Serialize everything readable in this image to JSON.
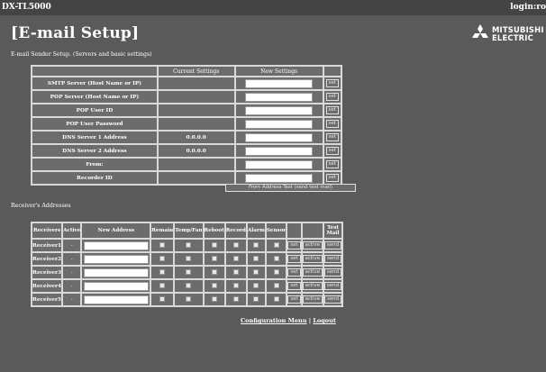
{
  "header": {
    "product": "DX-TL5000",
    "login": "login:ro",
    "title": "[E-mail Setup]",
    "subtitle": "E-mail Sender Setup. (Servers and basic settings)"
  },
  "logo": {
    "line1": "MITSUBISHI",
    "line2": "ELECTRIC"
  },
  "sender": {
    "columns": [
      "",
      "Current Settings",
      "New Settings",
      ""
    ],
    "rows": [
      {
        "label": "SMTP Server (Host Name or IP)",
        "current": "",
        "button": "set"
      },
      {
        "label": "POP Server (Host Name or IP)",
        "current": "",
        "button": "set"
      },
      {
        "label": "POP User ID",
        "current": "",
        "button": "set"
      },
      {
        "label": "POP User Password",
        "current": "",
        "button": "set"
      },
      {
        "label": "DNS Server 1 Address",
        "current": "0.0.0.0",
        "button": "set"
      },
      {
        "label": "DNS Server 2 Address",
        "current": "0.0.0.0",
        "button": "set"
      },
      {
        "label": "From:",
        "current": "",
        "button": "set"
      },
      {
        "label": "Recorder ID",
        "current": "",
        "button": "set"
      }
    ],
    "test_button": "From Address Test (send test mail)"
  },
  "receivers": {
    "title": "Receiver's Addresses",
    "columns": [
      "Receivers",
      "Active",
      "New Address",
      "Remain",
      "Temp/Fan",
      "Reboot",
      "Record",
      "Alarm",
      "Sensor",
      "",
      "",
      "Test Mail"
    ],
    "rows": [
      {
        "name": "Receiver1",
        "active": "-",
        "set": "set",
        "activate": "active",
        "send": "send"
      },
      {
        "name": "Receiver2",
        "active": "-",
        "set": "set",
        "activate": "active",
        "send": "send"
      },
      {
        "name": "Receiver3",
        "active": "-",
        "set": "set",
        "activate": "active",
        "send": "send"
      },
      {
        "name": "Receiver4",
        "active": "-",
        "set": "set",
        "activate": "active",
        "send": "send"
      },
      {
        "name": "Receiver5",
        "active": "-",
        "set": "set",
        "activate": "active",
        "send": "send"
      }
    ]
  },
  "footer": {
    "config_link": "Configuration Menu",
    "separator": "|",
    "logout_link": "Logout"
  },
  "colors": {
    "background": "#5a5a5a",
    "panel": "#6c6c6c",
    "border": "#d8d8d8"
  }
}
